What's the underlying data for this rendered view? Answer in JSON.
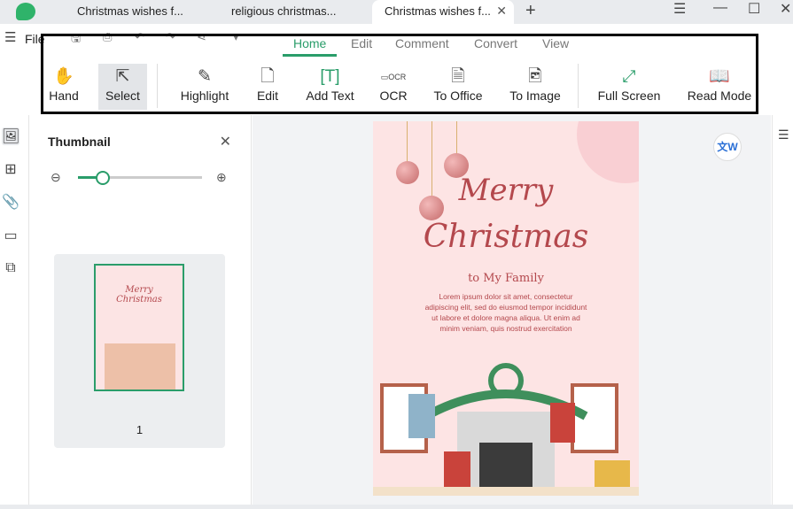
{
  "tabs": [
    {
      "label": "Christmas wishes f..."
    },
    {
      "label": "religious christmas..."
    },
    {
      "label": "Christmas wishes f...",
      "active": true
    }
  ],
  "menu": {
    "file": "File"
  },
  "ribbon_tabs": [
    "Home",
    "Edit",
    "Comment",
    "Convert",
    "View"
  ],
  "tools": [
    {
      "label": "Hand",
      "icon": "hand-icon"
    },
    {
      "label": "Select",
      "icon": "cursor-icon",
      "selected": true
    },
    {
      "label": "Highlight",
      "icon": "highlighter-icon"
    },
    {
      "label": "Edit",
      "icon": "edit-icon"
    },
    {
      "label": "Add Text",
      "icon": "add-text-icon"
    },
    {
      "label": "OCR",
      "icon": "ocr-icon"
    },
    {
      "label": "To Office",
      "icon": "to-office-icon"
    },
    {
      "label": "To Image",
      "icon": "to-image-icon"
    },
    {
      "label": "Full Screen",
      "icon": "full-screen-icon"
    },
    {
      "label": "Read Mode",
      "icon": "book-icon"
    }
  ],
  "panel": {
    "title": "Thumbnail",
    "page_number": "1",
    "zoom_level": 0.2
  },
  "document": {
    "title1": "Merry",
    "title2": "Christmas",
    "subtitle": "to My Family",
    "body": "Lorem ipsum dolor sit amet, consectetur adipiscing elit, sed do eiusmod tempor incididunt ut labore et dolore magna aliqua. Ut enim ad minim veniam, quis nostrud exercitation"
  },
  "colors": {
    "accent": "#2a9d6a",
    "doc_bg": "#fde4e4",
    "doc_text": "#b4484d"
  }
}
